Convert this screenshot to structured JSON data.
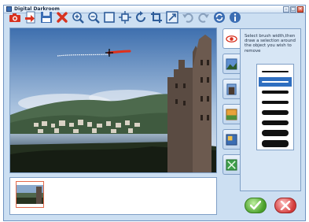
{
  "window": {
    "title": "Digital Darkroom",
    "min_glyph": "–",
    "max_glyph": "□",
    "close_glyph": "×"
  },
  "toolbar": {
    "buttons": [
      {
        "icon": "camera-icon"
      },
      {
        "icon": "import-icon"
      },
      {
        "icon": "save-icon"
      },
      {
        "icon": "delete-icon"
      },
      {
        "icon": "zoom-in-icon"
      },
      {
        "icon": "zoom-out-icon"
      },
      {
        "icon": "fit-screen-icon"
      },
      {
        "icon": "actual-size-icon"
      },
      {
        "icon": "rotate-icon"
      },
      {
        "icon": "crop-icon"
      },
      {
        "icon": "resize-icon"
      },
      {
        "icon": "undo-icon"
      },
      {
        "icon": "redo-icon"
      },
      {
        "icon": "refresh-icon"
      },
      {
        "icon": "info-icon"
      }
    ]
  },
  "side_tabs": [
    {
      "icon": "red-eye-icon",
      "active": true
    },
    {
      "icon": "landscape-icon",
      "active": false
    },
    {
      "icon": "portrait-icon",
      "active": false
    },
    {
      "icon": "color-fix-icon",
      "active": false
    },
    {
      "icon": "photo-effects-icon",
      "active": false
    },
    {
      "icon": "frame-icon",
      "active": false
    }
  ],
  "panel": {
    "instructions": "Select brush width,then draw a selection around the object you wish to remove",
    "brush_widths": [
      1,
      2,
      3,
      4,
      5,
      6,
      7,
      8
    ],
    "selected_index": 1
  },
  "actions": {
    "ok_icon": "checkmark-icon",
    "cancel_icon": "x-mark-icon"
  },
  "colors": {
    "accent": "#2f6fc0",
    "window_bg": "#ccdff2",
    "stroke_red": "#e0301a"
  }
}
